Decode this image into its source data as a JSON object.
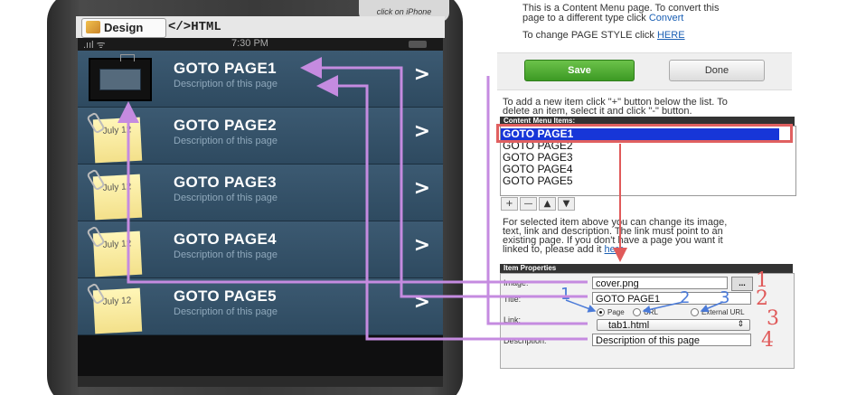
{
  "phone": {
    "tip": "click on iPhone",
    "design_tab": "Design",
    "html_tab": "</>HTML",
    "status": {
      "signal": ".ııl ᯤ",
      "time": "7:30 PM"
    },
    "rows": [
      {
        "title": "GOTO PAGE1",
        "desc": "Description of this page",
        "thumb": "frame"
      },
      {
        "title": "GOTO PAGE2",
        "desc": "Description of this page",
        "thumb": "note",
        "note_text": "July 12"
      },
      {
        "title": "GOTO PAGE3",
        "desc": "Description of this page",
        "thumb": "note",
        "note_text": "July 12"
      },
      {
        "title": "GOTO PAGE4",
        "desc": "Description of this page",
        "thumb": "note",
        "note_text": "July 12"
      },
      {
        "title": "GOTO PAGE5",
        "desc": "Description of this page",
        "thumb": "note",
        "note_text": "July 12"
      }
    ],
    "chevron": ">"
  },
  "panel": {
    "intro_line1": "This is a Content Menu page. To convert this",
    "intro_line2a": "page to a different type click ",
    "intro_convert": "Convert",
    "intro_line3a": "To change PAGE STYLE click ",
    "intro_here": "HERE",
    "save_label": "Save",
    "done_label": "Done",
    "help_line1": "To add a new item click \"+\" button below the list. To",
    "help_line2": "delete an item, select it and click \"-\" button.",
    "list_header": "Content Menu Items:",
    "list_items": [
      "GOTO PAGE1",
      "GOTO PAGE2",
      "GOTO PAGE3",
      "GOTO PAGE4",
      "GOTO PAGE5"
    ],
    "list_controls": [
      "+",
      "—",
      "▲",
      "▼"
    ],
    "sel_help_line1": "For selected item above you can change its image,",
    "sel_help_line2": "text, link and description. The link must point to an",
    "sel_help_line3": "existing page. If you don't have a page you want it",
    "sel_help_line4a": "linked to, please add it ",
    "sel_help_here": "here",
    "props_header": "Item Properties",
    "image_label": "Image:",
    "image_value": "cover.png",
    "browse_label": "...",
    "title_label": "Title:",
    "title_value": "GOTO PAGE1",
    "link_label": "Link:",
    "radio_page": "Page",
    "radio_url": "URL",
    "radio_external": "External URL",
    "link_value": "tab1.html",
    "select_arrow": "⇕",
    "desc_label": "Description:",
    "desc_value": "Description of this page"
  },
  "annotations": {
    "red_numbers": [
      "1",
      "2",
      "3",
      "4"
    ],
    "blue_numbers": [
      "1",
      "2",
      "3"
    ],
    "red_color": "#e05a5a",
    "arrow_color": "#c58be0",
    "blue_color": "#4a7ad8"
  }
}
